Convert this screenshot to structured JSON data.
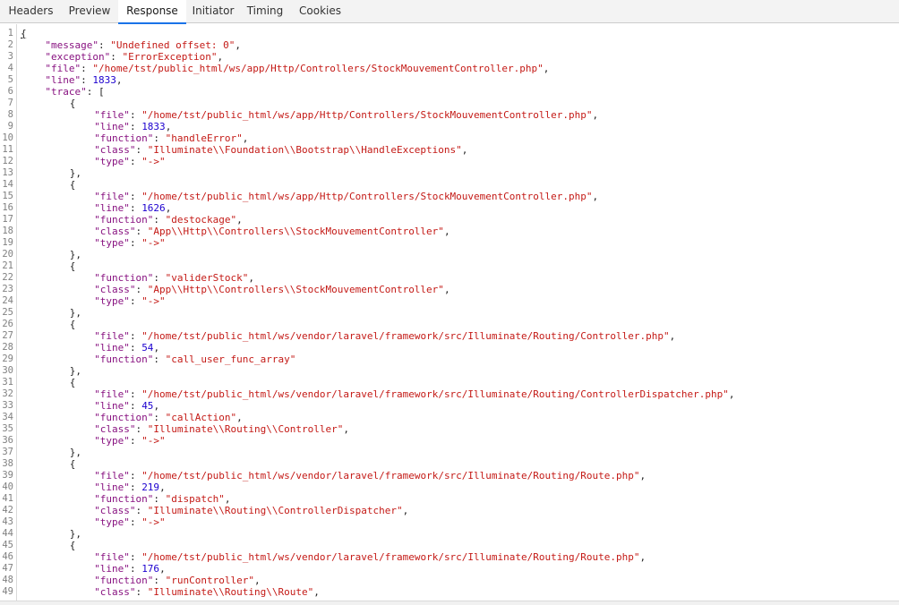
{
  "tabs": [
    {
      "label": "Headers",
      "active": false
    },
    {
      "label": "Preview",
      "active": false
    },
    {
      "label": "Response",
      "active": true
    },
    {
      "label": "Initiator",
      "active": false
    },
    {
      "label": "Timing",
      "active": false
    },
    {
      "label": "Cookies",
      "active": false
    }
  ],
  "colors": {
    "key": "#881280",
    "string": "#c41a16",
    "number": "#1c00cf",
    "punct": "#222222",
    "active_tab_underline": "#1a73e8"
  },
  "response_lines": [
    {
      "num": "1",
      "indent": 0,
      "text": "{"
    },
    {
      "num": "2",
      "indent": 1,
      "key": "\"message\"",
      "value": "\"Undefined offset: 0\"",
      "vtype": "s",
      "trail": ","
    },
    {
      "num": "3",
      "indent": 1,
      "key": "\"exception\"",
      "value": "\"ErrorException\"",
      "vtype": "s",
      "trail": ","
    },
    {
      "num": "4",
      "indent": 1,
      "key": "\"file\"",
      "value": "\"/home/tst/public_html/ws/app/Http/Controllers/StockMouvementController.php\"",
      "vtype": "s",
      "trail": ","
    },
    {
      "num": "5",
      "indent": 1,
      "key": "\"line\"",
      "value": "1833",
      "vtype": "n",
      "trail": ","
    },
    {
      "num": "6",
      "indent": 1,
      "key": "\"trace\"",
      "after": " [",
      "trail": ""
    },
    {
      "num": "7",
      "indent": 2,
      "text": "{"
    },
    {
      "num": "8",
      "indent": 3,
      "key": "\"file\"",
      "value": "\"/home/tst/public_html/ws/app/Http/Controllers/StockMouvementController.php\"",
      "vtype": "s",
      "trail": ","
    },
    {
      "num": "9",
      "indent": 3,
      "key": "\"line\"",
      "value": "1833",
      "vtype": "n",
      "trail": ","
    },
    {
      "num": "10",
      "indent": 3,
      "key": "\"function\"",
      "value": "\"handleError\"",
      "vtype": "s",
      "trail": ","
    },
    {
      "num": "11",
      "indent": 3,
      "key": "\"class\"",
      "value": "\"Illuminate\\\\Foundation\\\\Bootstrap\\\\HandleExceptions\"",
      "vtype": "s",
      "trail": ","
    },
    {
      "num": "12",
      "indent": 3,
      "key": "\"type\"",
      "value": "\"->\"",
      "vtype": "s",
      "trail": ""
    },
    {
      "num": "13",
      "indent": 2,
      "text": "},"
    },
    {
      "num": "14",
      "indent": 2,
      "text": "{"
    },
    {
      "num": "15",
      "indent": 3,
      "key": "\"file\"",
      "value": "\"/home/tst/public_html/ws/app/Http/Controllers/StockMouvementController.php\"",
      "vtype": "s",
      "trail": ","
    },
    {
      "num": "16",
      "indent": 3,
      "key": "\"line\"",
      "value": "1626",
      "vtype": "n",
      "trail": ","
    },
    {
      "num": "17",
      "indent": 3,
      "key": "\"function\"",
      "value": "\"destockage\"",
      "vtype": "s",
      "trail": ","
    },
    {
      "num": "18",
      "indent": 3,
      "key": "\"class\"",
      "value": "\"App\\\\Http\\\\Controllers\\\\StockMouvementController\"",
      "vtype": "s",
      "trail": ","
    },
    {
      "num": "19",
      "indent": 3,
      "key": "\"type\"",
      "value": "\"->\"",
      "vtype": "s",
      "trail": ""
    },
    {
      "num": "20",
      "indent": 2,
      "text": "},"
    },
    {
      "num": "21",
      "indent": 2,
      "text": "{"
    },
    {
      "num": "22",
      "indent": 3,
      "key": "\"function\"",
      "value": "\"validerStock\"",
      "vtype": "s",
      "trail": ","
    },
    {
      "num": "23",
      "indent": 3,
      "key": "\"class\"",
      "value": "\"App\\\\Http\\\\Controllers\\\\StockMouvementController\"",
      "vtype": "s",
      "trail": ","
    },
    {
      "num": "24",
      "indent": 3,
      "key": "\"type\"",
      "value": "\"->\"",
      "vtype": "s",
      "trail": ""
    },
    {
      "num": "25",
      "indent": 2,
      "text": "},"
    },
    {
      "num": "26",
      "indent": 2,
      "text": "{"
    },
    {
      "num": "27",
      "indent": 3,
      "key": "\"file\"",
      "value": "\"/home/tst/public_html/ws/vendor/laravel/framework/src/Illuminate/Routing/Controller.php\"",
      "vtype": "s",
      "trail": ","
    },
    {
      "num": "28",
      "indent": 3,
      "key": "\"line\"",
      "value": "54",
      "vtype": "n",
      "trail": ","
    },
    {
      "num": "29",
      "indent": 3,
      "key": "\"function\"",
      "value": "\"call_user_func_array\"",
      "vtype": "s",
      "trail": ""
    },
    {
      "num": "30",
      "indent": 2,
      "text": "},"
    },
    {
      "num": "31",
      "indent": 2,
      "text": "{"
    },
    {
      "num": "32",
      "indent": 3,
      "key": "\"file\"",
      "value": "\"/home/tst/public_html/ws/vendor/laravel/framework/src/Illuminate/Routing/ControllerDispatcher.php\"",
      "vtype": "s",
      "trail": ","
    },
    {
      "num": "33",
      "indent": 3,
      "key": "\"line\"",
      "value": "45",
      "vtype": "n",
      "trail": ","
    },
    {
      "num": "34",
      "indent": 3,
      "key": "\"function\"",
      "value": "\"callAction\"",
      "vtype": "s",
      "trail": ","
    },
    {
      "num": "35",
      "indent": 3,
      "key": "\"class\"",
      "value": "\"Illuminate\\\\Routing\\\\Controller\"",
      "vtype": "s",
      "trail": ","
    },
    {
      "num": "36",
      "indent": 3,
      "key": "\"type\"",
      "value": "\"->\"",
      "vtype": "s",
      "trail": ""
    },
    {
      "num": "37",
      "indent": 2,
      "text": "},"
    },
    {
      "num": "38",
      "indent": 2,
      "text": "{"
    },
    {
      "num": "39",
      "indent": 3,
      "key": "\"file\"",
      "value": "\"/home/tst/public_html/ws/vendor/laravel/framework/src/Illuminate/Routing/Route.php\"",
      "vtype": "s",
      "trail": ","
    },
    {
      "num": "40",
      "indent": 3,
      "key": "\"line\"",
      "value": "219",
      "vtype": "n",
      "trail": ","
    },
    {
      "num": "41",
      "indent": 3,
      "key": "\"function\"",
      "value": "\"dispatch\"",
      "vtype": "s",
      "trail": ","
    },
    {
      "num": "42",
      "indent": 3,
      "key": "\"class\"",
      "value": "\"Illuminate\\\\Routing\\\\ControllerDispatcher\"",
      "vtype": "s",
      "trail": ","
    },
    {
      "num": "43",
      "indent": 3,
      "key": "\"type\"",
      "value": "\"->\"",
      "vtype": "s",
      "trail": ""
    },
    {
      "num": "44",
      "indent": 2,
      "text": "},"
    },
    {
      "num": "45",
      "indent": 2,
      "text": "{"
    },
    {
      "num": "46",
      "indent": 3,
      "key": "\"file\"",
      "value": "\"/home/tst/public_html/ws/vendor/laravel/framework/src/Illuminate/Routing/Route.php\"",
      "vtype": "s",
      "trail": ","
    },
    {
      "num": "47",
      "indent": 3,
      "key": "\"line\"",
      "value": "176",
      "vtype": "n",
      "trail": ","
    },
    {
      "num": "48",
      "indent": 3,
      "key": "\"function\"",
      "value": "\"runController\"",
      "vtype": "s",
      "trail": ","
    },
    {
      "num": "49",
      "indent": 3,
      "key": "\"class\"",
      "value": "\"Illuminate\\\\Routing\\\\Route\"",
      "vtype": "s",
      "trail": ","
    }
  ]
}
